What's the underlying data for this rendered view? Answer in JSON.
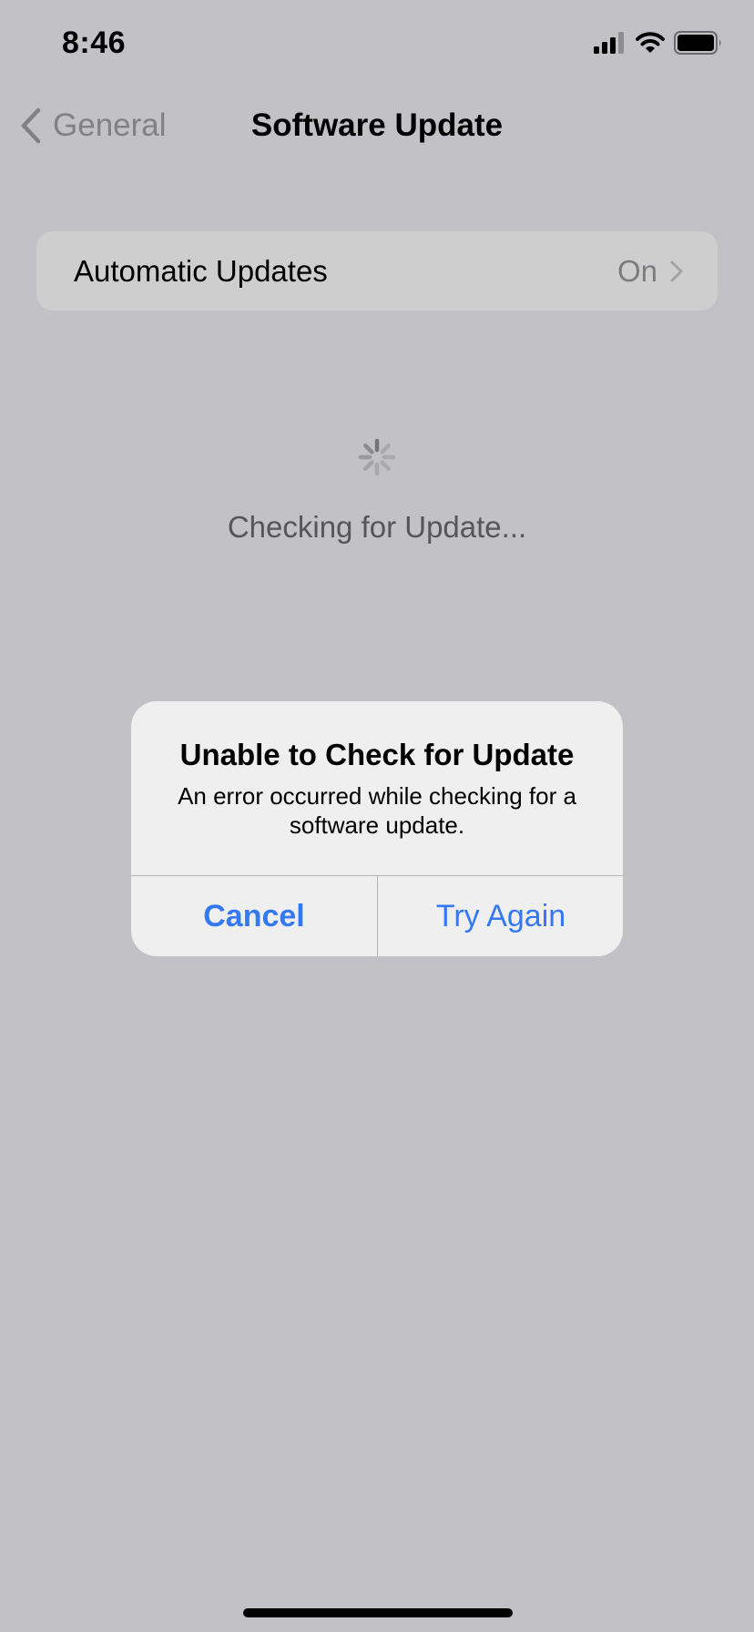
{
  "status_bar": {
    "time": "8:46",
    "icons": [
      "cellular-signal-icon",
      "wifi-icon",
      "battery-icon"
    ],
    "signal_bars_active": 3,
    "signal_bars_total": 4
  },
  "nav": {
    "back_label": "General",
    "back_icon": "chevron-left-icon",
    "title": "Software Update"
  },
  "settings": {
    "automatic_updates": {
      "label": "Automatic Updates",
      "value": "On",
      "icon": "chevron-right-icon"
    }
  },
  "status": {
    "spinner_icon": "activity-spinner-icon",
    "text": "Checking for Update..."
  },
  "alert": {
    "title": "Unable to Check for Update",
    "message": "An error occurred while checking for a software update.",
    "buttons": {
      "cancel": "Cancel",
      "try_again": "Try Again"
    }
  },
  "colors": {
    "background": "#c2c1c6",
    "accent": "#3478f6",
    "dialog_bg": "#efeff0",
    "row_bg": "#cececf",
    "secondary_text": "#7c7c80"
  }
}
